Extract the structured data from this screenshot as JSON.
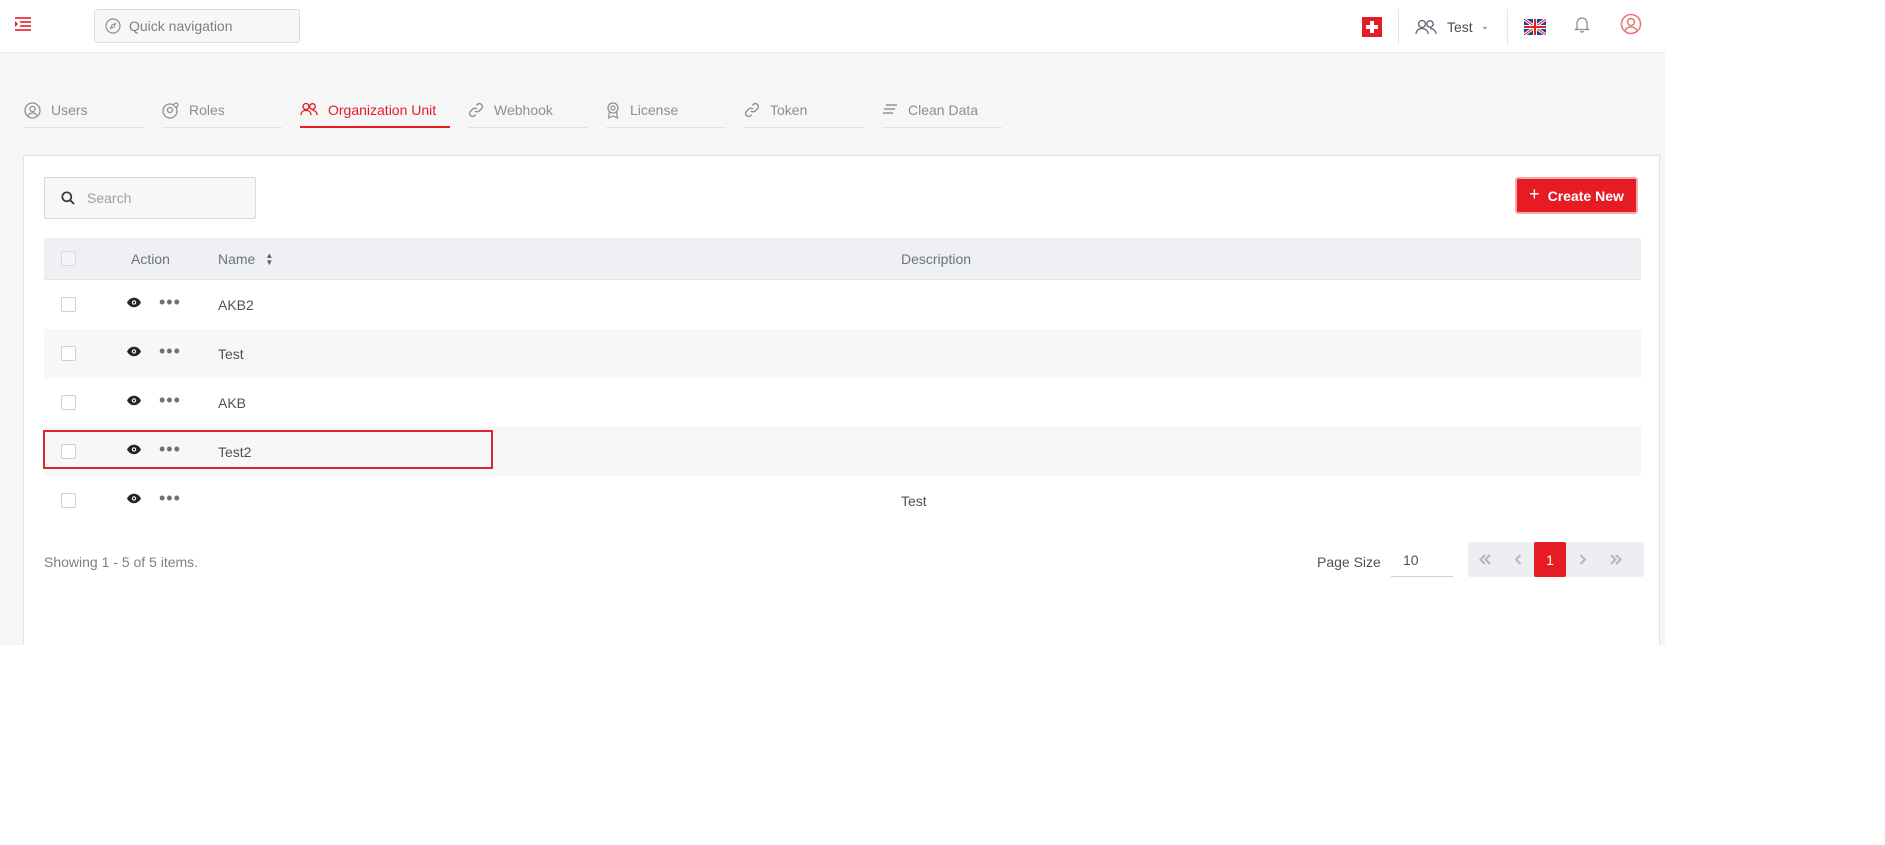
{
  "header": {
    "quick_nav_placeholder": "Quick navigation",
    "tenant_name": "Test",
    "brand_color": "#e51c23"
  },
  "tabs": [
    {
      "label": "Users",
      "icon": "user-circle-icon",
      "active": false
    },
    {
      "label": "Roles",
      "icon": "role-icon",
      "active": false
    },
    {
      "label": "Organization Unit",
      "icon": "users-icon",
      "active": true
    },
    {
      "label": "Webhook",
      "icon": "link-icon",
      "active": false
    },
    {
      "label": "License",
      "icon": "badge-icon",
      "active": false
    },
    {
      "label": "Token",
      "icon": "link-icon",
      "active": false
    },
    {
      "label": "Clean Data",
      "icon": "lines-icon",
      "active": false
    }
  ],
  "toolbar": {
    "search_placeholder": "Search",
    "create_label": "Create New"
  },
  "table": {
    "headers": {
      "action": "Action",
      "name": "Name",
      "description": "Description"
    },
    "rows": [
      {
        "name": "AKB2",
        "description": ""
      },
      {
        "name": "Test",
        "description": ""
      },
      {
        "name": "AKB",
        "description": ""
      },
      {
        "name": "Test2",
        "description": ""
      },
      {
        "name": "",
        "description": "Test"
      }
    ]
  },
  "footer": {
    "summary": "Showing 1 - 5 of 5 items.",
    "page_size_label": "Page Size",
    "page_size_value": "10",
    "current_page": "1"
  }
}
